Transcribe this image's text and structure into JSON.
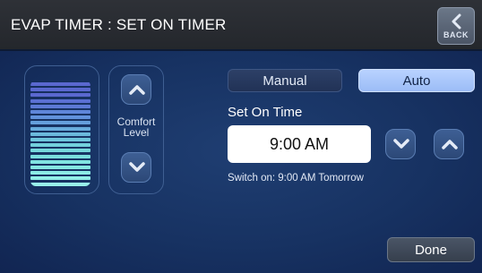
{
  "header": {
    "title": "EVAP TIMER : SET ON TIMER",
    "back_label": "BACK",
    "back_icon": "chevron-left-icon"
  },
  "comfort": {
    "label_line1": "Comfort",
    "label_line2": "Level",
    "up_icon": "chevron-up-icon",
    "down_icon": "chevron-down-icon",
    "bar_colors_top_to_bottom": [
      "#5a68cf",
      "#5a68cf",
      "#5a68cf",
      "#5b70d3",
      "#5d7ad6",
      "#5f86d9",
      "#6292dc",
      "#659fdc",
      "#68acdc",
      "#6bb9dc",
      "#6ec5dc",
      "#72d0dc",
      "#76d8dc",
      "#7adede",
      "#80e3e1",
      "#86e7e3",
      "#8cebe6",
      "#92eee8",
      "#98f0ea"
    ]
  },
  "mode": {
    "manual_label": "Manual",
    "auto_label": "Auto",
    "selected": "Auto"
  },
  "timer": {
    "section_label": "Set On Time",
    "time_value": "9:00 AM",
    "decrement_icon": "chevron-down-icon",
    "increment_icon": "chevron-up-icon",
    "switch_on_text": "Switch on: 9:00 AM Tomorrow"
  },
  "footer": {
    "done_label": "Done"
  }
}
